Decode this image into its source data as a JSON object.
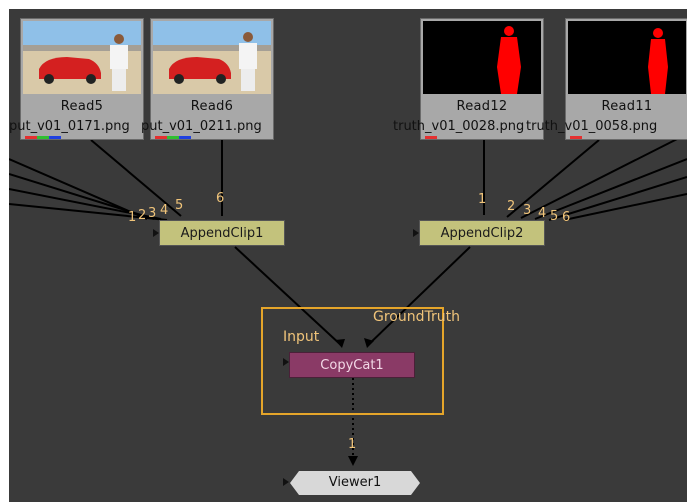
{
  "nodes": {
    "read5": {
      "name": "Read5",
      "file": "put_v01_0171.png"
    },
    "read6": {
      "name": "Read6",
      "file": "put_v01_0211.png"
    },
    "read12": {
      "name": "Read12",
      "file": "truth_v01_0028.png"
    },
    "read11": {
      "name": "Read11",
      "file": "truth_v01_0058.png"
    },
    "appendclip1": {
      "name": "AppendClip1",
      "ports": [
        "1",
        "2",
        "3",
        "4",
        "5",
        "6"
      ]
    },
    "appendclip2": {
      "name": "AppendClip2",
      "ports": [
        "1",
        "2",
        "3",
        "4",
        "5",
        "6"
      ]
    },
    "copycat1": {
      "name": "CopyCat1",
      "input_label": "Input",
      "groundtruth_label": "GroundTruth"
    },
    "viewer1": {
      "name": "Viewer1",
      "port": "1"
    }
  },
  "colors": {
    "graph_bg": "#3a3a3a",
    "append_node": "#c3c27c",
    "copycat_node": "#8a3a66",
    "backdrop_border": "#e5a52a",
    "port_label": "#f0c47a",
    "matte_red": "#ff0000"
  }
}
